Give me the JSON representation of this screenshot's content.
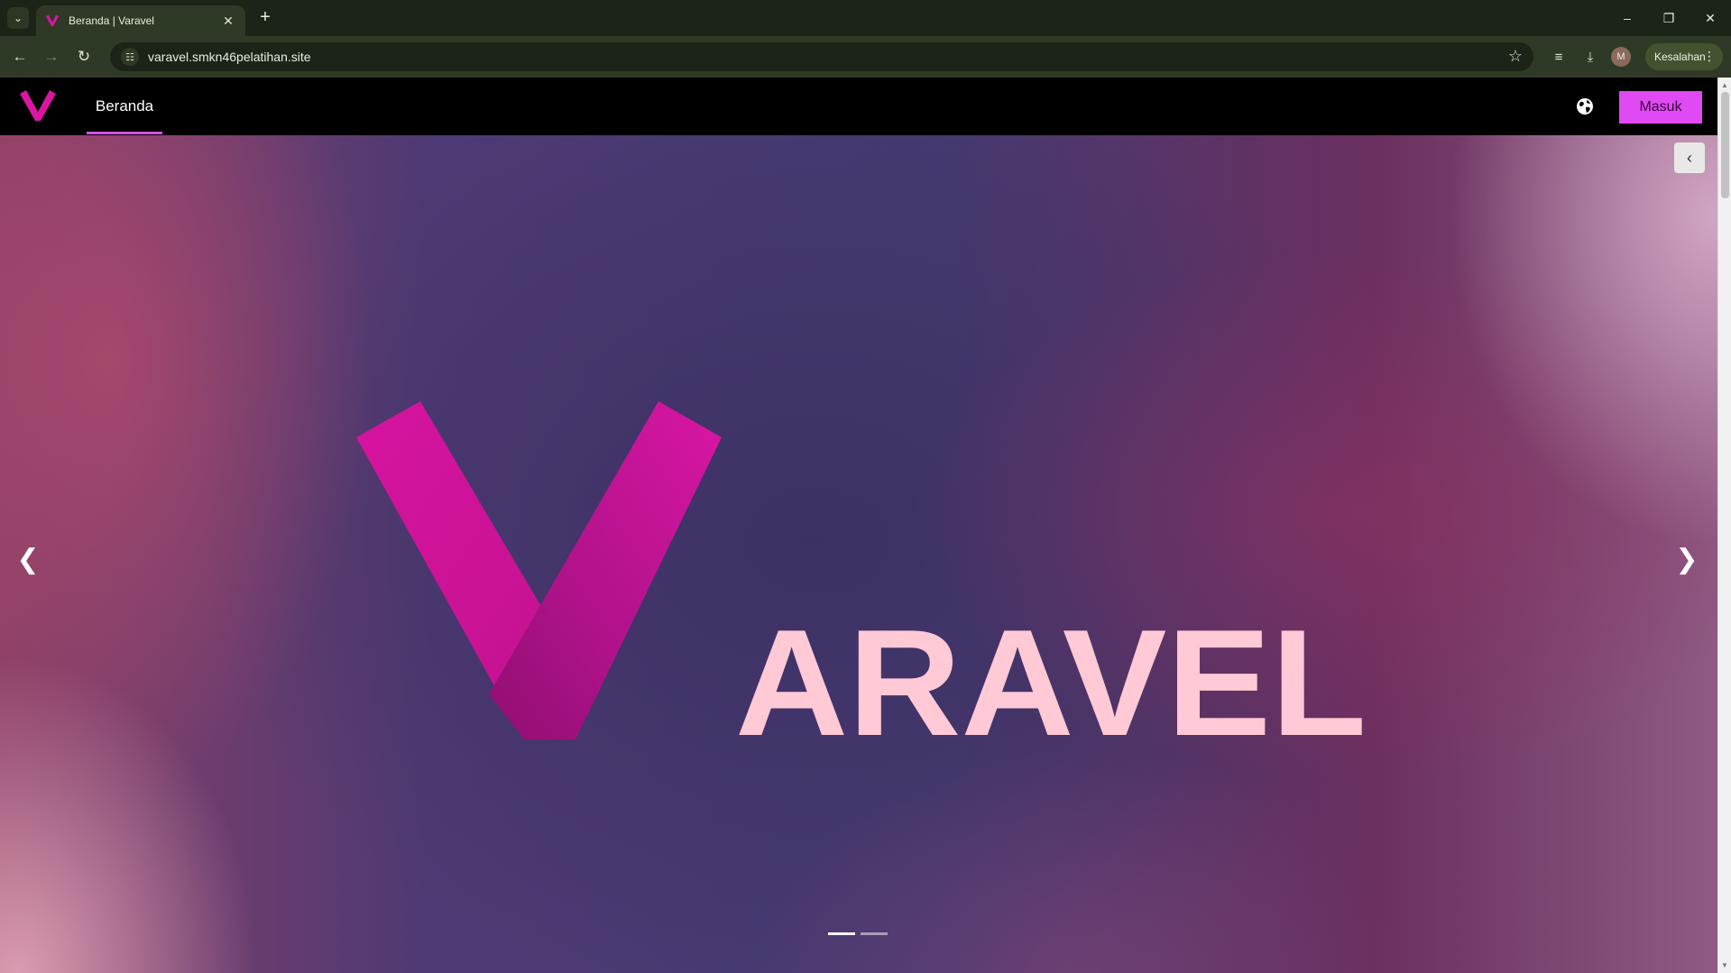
{
  "browser": {
    "tab_title": "Beranda | Varavel",
    "url": "varavel.smkn46pelatihan.site",
    "profile_initial": "M",
    "error_chip_label": "Kesalahan",
    "icons": {
      "tab_search": "chevron-down-icon",
      "tab_close": "close-icon",
      "new_tab": "plus-icon",
      "back": "arrow-left-icon",
      "forward": "arrow-right-icon",
      "reload": "reload-icon",
      "site_info": "site-info-icon",
      "bookmark": "star-icon",
      "media": "media-control-icon",
      "downloads": "download-icon",
      "menu": "kebab-menu-icon"
    }
  },
  "site": {
    "nav_items": [
      {
        "label": "Beranda",
        "active": true
      }
    ],
    "login_label": "Masuk",
    "accent_color": "#e04af2",
    "hero": {
      "wordmark": "ARAVEL",
      "logo_letter_color": "#d9169f",
      "wordmark_color": "#ffc9d6",
      "slide_count": 2,
      "active_slide": 1
    }
  }
}
